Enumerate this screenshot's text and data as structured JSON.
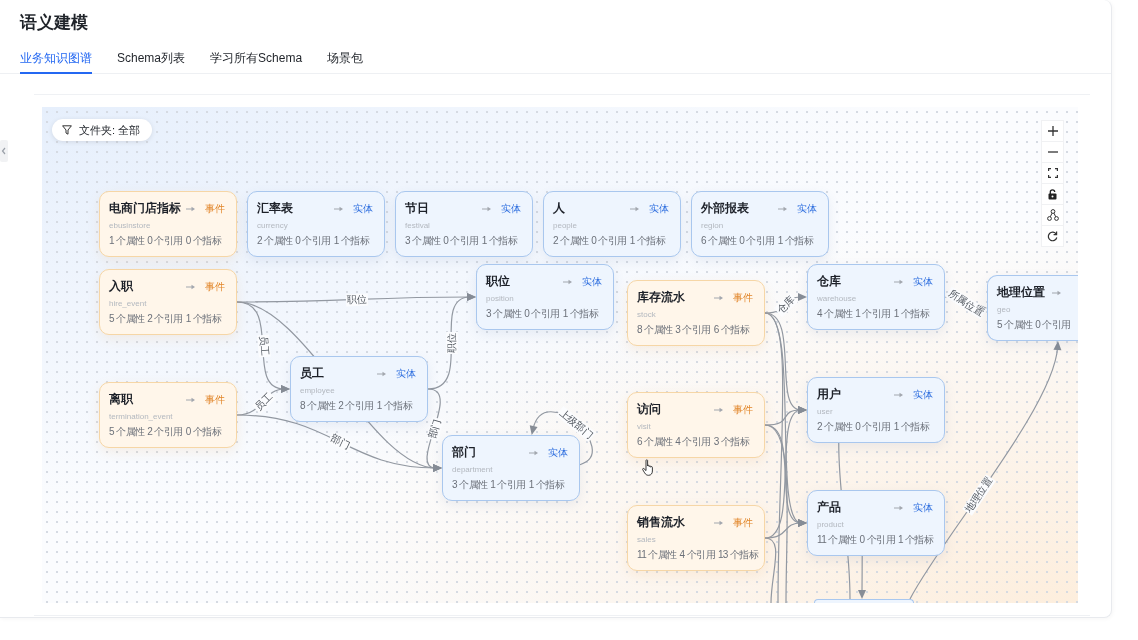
{
  "page": {
    "title": "语义建模"
  },
  "tabs": [
    {
      "label": "业务知识图谱",
      "selected": true
    },
    {
      "label": "Schema列表",
      "selected": false
    },
    {
      "label": "学习所有Schema",
      "selected": false
    },
    {
      "label": "场景包",
      "selected": false
    }
  ],
  "graph": {
    "filter": {
      "label": "文件夹: 全部"
    },
    "nodes": [
      {
        "kind": "event",
        "title": "电商门店指标",
        "tag": "事件",
        "name": "ebusinstore",
        "counts": [
          "1 个属性",
          "0 个引用",
          "0 个指标"
        ]
      },
      {
        "kind": "entity",
        "title": "汇率表",
        "tag": "实体",
        "name": "currency",
        "counts": [
          "2 个属性",
          "0 个引用",
          "1 个指标"
        ]
      },
      {
        "kind": "entity",
        "title": "节日",
        "tag": "实体",
        "name": "festival",
        "counts": [
          "3 个属性",
          "0 个引用",
          "1 个指标"
        ]
      },
      {
        "kind": "entity",
        "title": "人",
        "tag": "实体",
        "name": "people",
        "counts": [
          "2 个属性",
          "0 个引用",
          "1 个指标"
        ]
      },
      {
        "kind": "entity",
        "title": "外部报表",
        "tag": "实体",
        "name": "region",
        "counts": [
          "6 个属性",
          "0 个引用",
          "1 个指标"
        ]
      },
      {
        "kind": "event",
        "title": "入职",
        "tag": "事件",
        "name": "hire_event",
        "counts": [
          "5 个属性",
          "2 个引用",
          "1 个指标"
        ]
      },
      {
        "kind": "event",
        "title": "离职",
        "tag": "事件",
        "name": "termination_event",
        "counts": [
          "5 个属性",
          "2 个引用",
          "0 个指标"
        ]
      },
      {
        "kind": "entity",
        "title": "员工",
        "tag": "实体",
        "name": "employee",
        "counts": [
          "8 个属性",
          "2 个引用",
          "1 个指标"
        ]
      },
      {
        "kind": "entity",
        "title": "职位",
        "tag": "实体",
        "name": "position",
        "counts": [
          "3 个属性",
          "0 个引用",
          "1 个指标"
        ]
      },
      {
        "kind": "entity",
        "title": "部门",
        "tag": "实体",
        "name": "department",
        "counts": [
          "3 个属性",
          "1 个引用",
          "1 个指标"
        ]
      },
      {
        "kind": "event",
        "title": "库存流水",
        "tag": "事件",
        "name": "stock",
        "counts": [
          "8 个属性",
          "3 个引用",
          "6 个指标"
        ]
      },
      {
        "kind": "entity",
        "title": "仓库",
        "tag": "实体",
        "name": "warehouse",
        "counts": [
          "4 个属性",
          "1 个引用",
          "1 个指标"
        ]
      },
      {
        "kind": "entity",
        "title": "地理位置",
        "name": "geo",
        "counts": [
          "5 个属性",
          "0 个引用"
        ]
      },
      {
        "kind": "event",
        "title": "访问",
        "tag": "事件",
        "name": "visit",
        "counts": [
          "6 个属性",
          "4 个引用",
          "3 个指标"
        ]
      },
      {
        "kind": "entity",
        "title": "用户",
        "tag": "实体",
        "name": "user",
        "counts": [
          "2 个属性",
          "0 个引用",
          "1 个指标"
        ]
      },
      {
        "kind": "event",
        "title": "销售流水",
        "tag": "事件",
        "name": "sales",
        "counts": [
          "11 个属性",
          "4 个引用",
          "13 个指标"
        ]
      },
      {
        "kind": "entity",
        "title": "产品",
        "tag": "实体",
        "name": "product",
        "counts": [
          "11 个属性",
          "0 个引用",
          "1 个指标"
        ]
      }
    ],
    "edges": [
      {
        "label": "职位"
      },
      {
        "label": "员工"
      },
      {
        "label": "员工"
      },
      {
        "label": "部门"
      },
      {
        "label": "职位"
      },
      {
        "label": "部门"
      },
      {
        "label": "上级部门"
      },
      {
        "label": "仓库"
      },
      {
        "label": "所属位置"
      },
      {
        "label": "地理位置"
      }
    ]
  }
}
